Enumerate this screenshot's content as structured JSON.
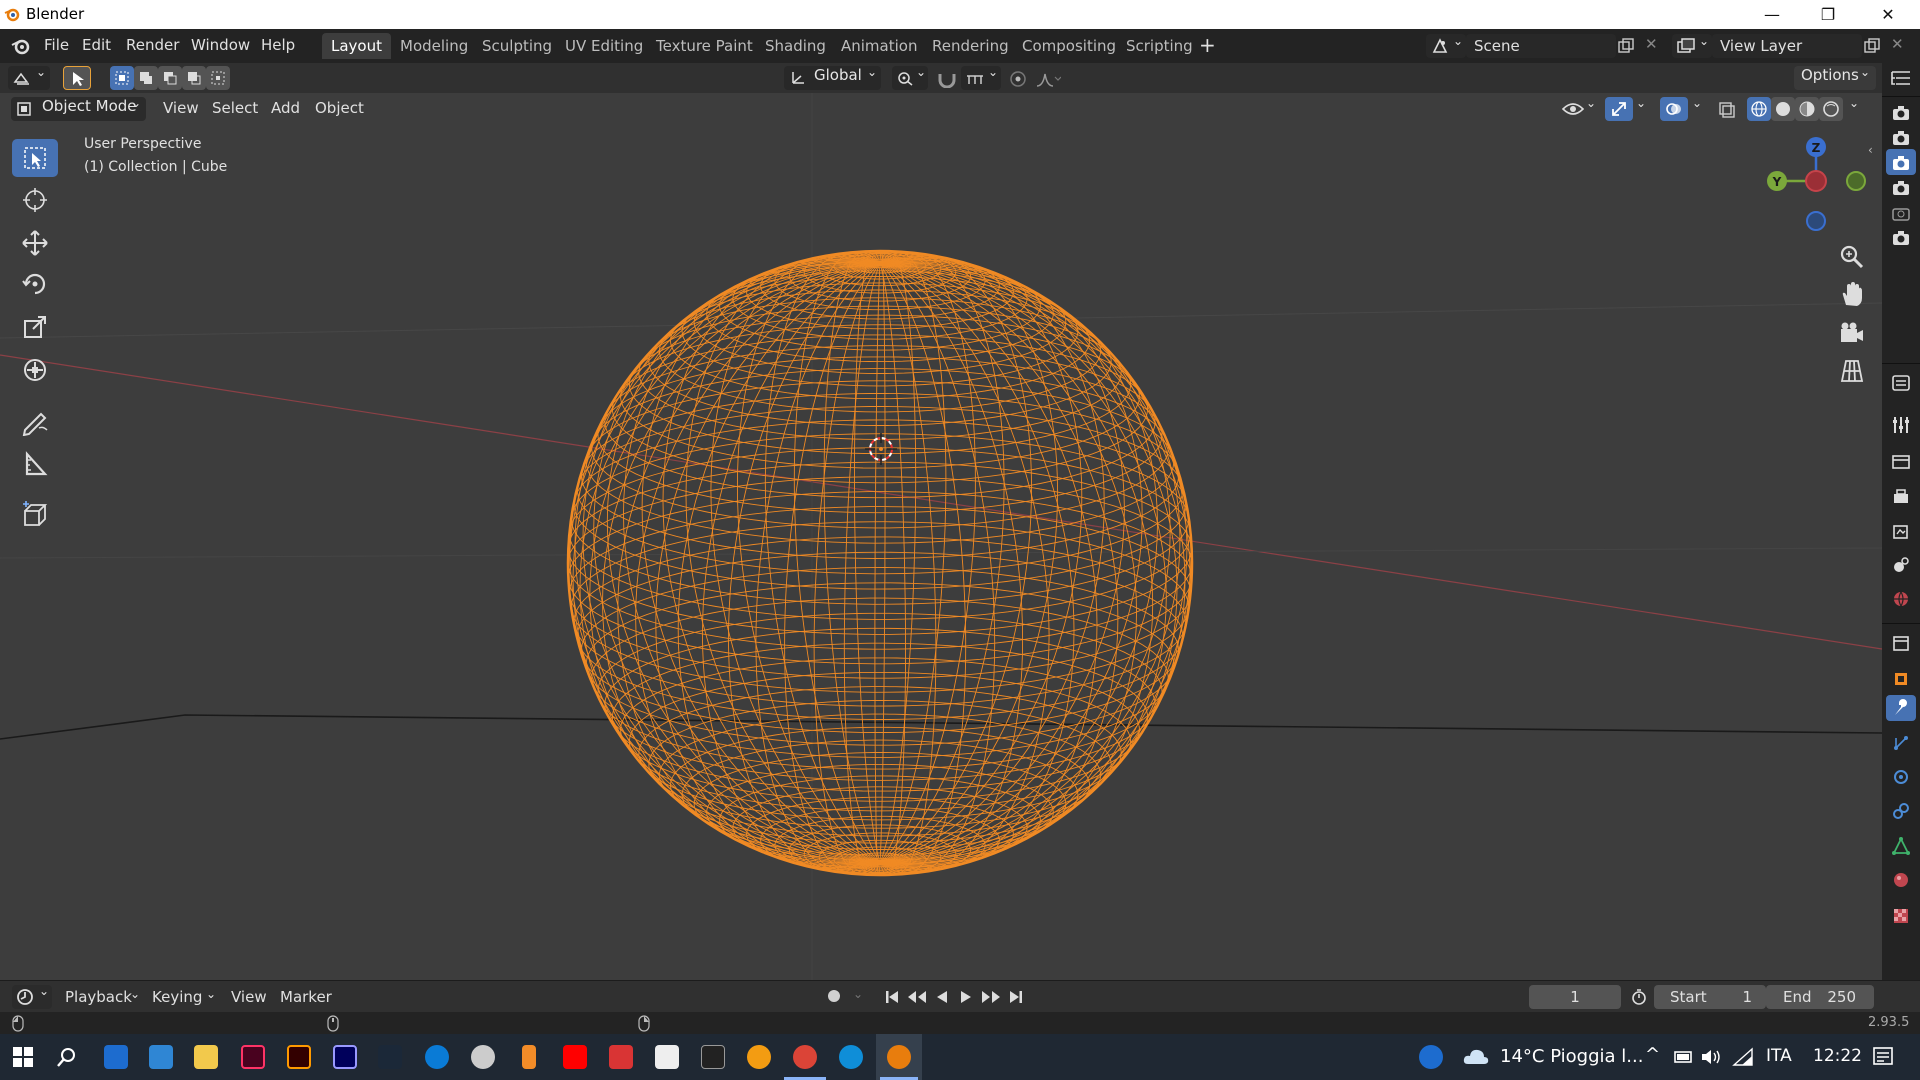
{
  "window": {
    "title": "Blender"
  },
  "menu": [
    "File",
    "Edit",
    "Render",
    "Window",
    "Help"
  ],
  "workspaces": [
    "Layout",
    "Modeling",
    "Sculpting",
    "UV Editing",
    "Texture Paint",
    "Shading",
    "Animation",
    "Rendering",
    "Compositing",
    "Scripting"
  ],
  "active_workspace": "Layout",
  "scene": {
    "name": "Scene"
  },
  "view_layer": {
    "name": "View Layer"
  },
  "header": {
    "transform_orientation": "Global",
    "options_label": "Options"
  },
  "viewport_header": {
    "mode": "Object Mode",
    "menus": [
      "View",
      "Select",
      "Add",
      "Object"
    ]
  },
  "overlay_text": {
    "line1": "User Perspective",
    "line2": "(1) Collection | Cube"
  },
  "gizmo": {
    "z": "Z",
    "y": "Y"
  },
  "timeline": {
    "menus": [
      "Playback",
      "Keying",
      "View",
      "Marker"
    ],
    "current_frame": "1",
    "start_label": "Start",
    "start_value": "1",
    "end_label": "End",
    "end_value": "250"
  },
  "status": {
    "version": "2.93.5"
  },
  "taskbar": {
    "weather": "14°C  Pioggia l...",
    "language": "ITA",
    "time": "12:22"
  },
  "colors": {
    "selected_wire": "#f08a24",
    "active_tool": "#4772b3",
    "x_axis": "#c6434a",
    "y_axis": "#7ba83b",
    "z_axis": "#3a6fd0"
  }
}
